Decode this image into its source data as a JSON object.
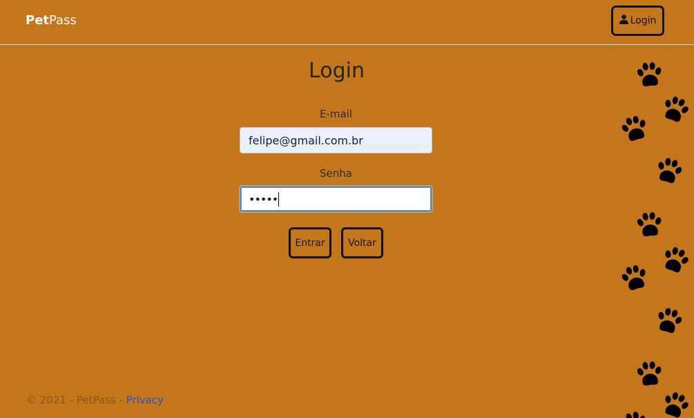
{
  "navbar": {
    "brand_pet": "Pet",
    "brand_pass": "Pass",
    "login_label": "Login",
    "login_icon": "user-icon"
  },
  "main": {
    "title": "Login",
    "email_label": "E-mail",
    "email_value": "felipe@gmail.com.br",
    "password_label": "Senha",
    "password_value": "•••••",
    "submit_label": "Entrar",
    "back_label": "Voltar"
  },
  "footer": {
    "copyright": "© 2021 - PetPass - ",
    "privacy_label": "Privacy"
  },
  "decor": {
    "paw_icon": "paw-print-icon"
  },
  "colors": {
    "background": "#c4761b",
    "link": "#2a55c9",
    "email_autofill": "#e8f0fe"
  }
}
